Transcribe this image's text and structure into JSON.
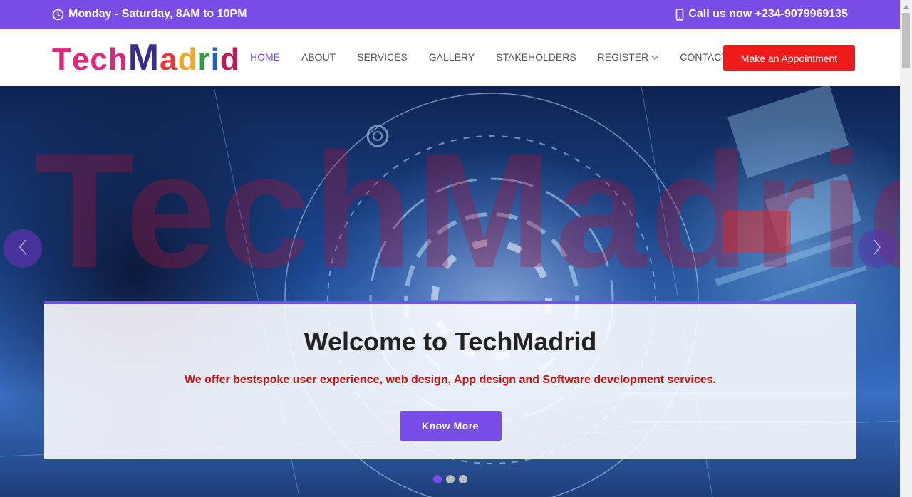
{
  "topbar": {
    "hours": "Monday - Saturday, 8AM to 10PM",
    "phone": "Call us now +234-9079969135",
    "hours_icon": "clock-icon",
    "phone_icon": "mobile-phone-icon"
  },
  "logo": {
    "letters": [
      {
        "char": "T",
        "color": "#e0257a"
      },
      {
        "char": "e",
        "color": "#e0257a"
      },
      {
        "char": "c",
        "color": "#e0257a"
      },
      {
        "char": "h",
        "color": "#e0257a"
      },
      {
        "char": "M",
        "color": "#3b2d8f"
      },
      {
        "char": "a",
        "color": "#e53935"
      },
      {
        "char": "d",
        "color": "#f5a623"
      },
      {
        "char": "r",
        "color": "#2e9e3a"
      },
      {
        "char": "i",
        "color": "#1e63c7"
      },
      {
        "char": "d",
        "color": "#c2185b"
      }
    ]
  },
  "nav": {
    "items": [
      {
        "label": "HOME",
        "active": true
      },
      {
        "label": "ABOUT"
      },
      {
        "label": "SERVICES"
      },
      {
        "label": "GALLERY"
      },
      {
        "label": "STAKEHOLDERS"
      },
      {
        "label": "REGISTER",
        "dropdown": true
      },
      {
        "label": "CONTACT"
      }
    ],
    "appointment_label": "Make an Appointment"
  },
  "hero": {
    "watermark": "TechMadrid",
    "title": "Welcome to TechMadrid",
    "subtitle": "We offer bestspoke user experience, web design, App design and Software development services.",
    "button_label": "Know More",
    "slides": 3,
    "active_slide": 0
  },
  "colors": {
    "brand": "#7b4de8",
    "cta": "#ef1b1b",
    "subtitle": "#cc1111"
  }
}
